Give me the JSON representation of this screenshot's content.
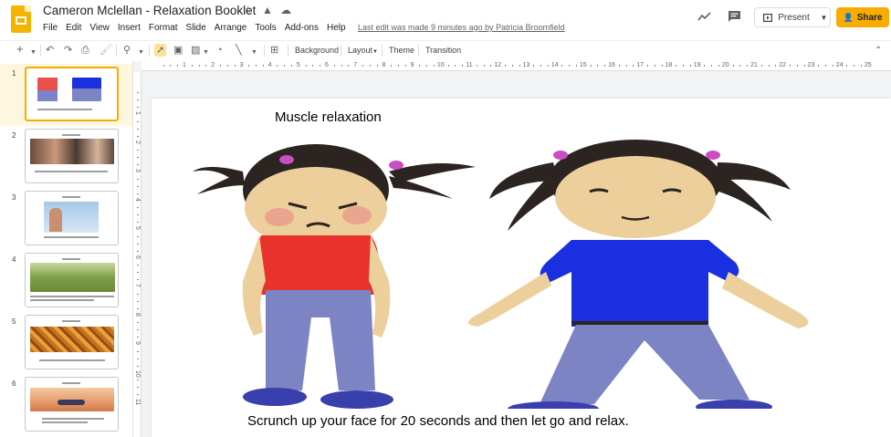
{
  "header": {
    "title": "Cameron Mclellan - Relaxation Booklet",
    "last_edit": "Last edit was made 9 minutes ago by Patricia Broomfield",
    "menu": [
      "File",
      "Edit",
      "View",
      "Insert",
      "Format",
      "Slide",
      "Arrange",
      "Tools",
      "Add-ons",
      "Help"
    ],
    "present_label": "Present",
    "share_label": "Share",
    "icons": [
      "star-icon",
      "move-to-folder-icon",
      "cloud-status-icon",
      "activity-trend-icon",
      "comments-icon",
      "present-icon",
      "share-person-icon"
    ]
  },
  "toolbar": {
    "buttons": [
      "new-slide",
      "undo",
      "redo",
      "print",
      "paint-format",
      "zoom",
      "select",
      "text-box",
      "image",
      "shape",
      "line",
      "comment"
    ],
    "background_label": "Background",
    "layout_label": "Layout",
    "theme_label": "Theme",
    "transition_label": "Transition"
  },
  "filmstrip": {
    "slides": [
      {
        "number": "1",
        "active": true
      },
      {
        "number": "2",
        "active": false
      },
      {
        "number": "3",
        "active": false
      },
      {
        "number": "4",
        "active": false
      },
      {
        "number": "5",
        "active": false
      },
      {
        "number": "6",
        "active": false
      }
    ]
  },
  "ruler": {
    "horizontal": [
      "1",
      "2",
      "3",
      "4",
      "5",
      "6",
      "7",
      "8",
      "9",
      "10",
      "11",
      "12",
      "13",
      "14",
      "15",
      "16",
      "17",
      "18",
      "19",
      "20",
      "21",
      "22",
      "23",
      "24",
      "25"
    ],
    "vertical": [
      "1",
      "2",
      "3",
      "4",
      "5",
      "6",
      "7",
      "8",
      "9",
      "10",
      "11"
    ]
  },
  "slide": {
    "title": "Muscle relaxation",
    "caption": "Scrunch up your face for 20 seconds and then let go and relax."
  },
  "colors": {
    "accent": "#f9ab00",
    "active_slide_bg": "#fef7e0",
    "shirt_red": "#e8322b",
    "shirt_blue": "#1a2fe0",
    "pants": "#7d84c4",
    "skin": "#eccf9b"
  }
}
